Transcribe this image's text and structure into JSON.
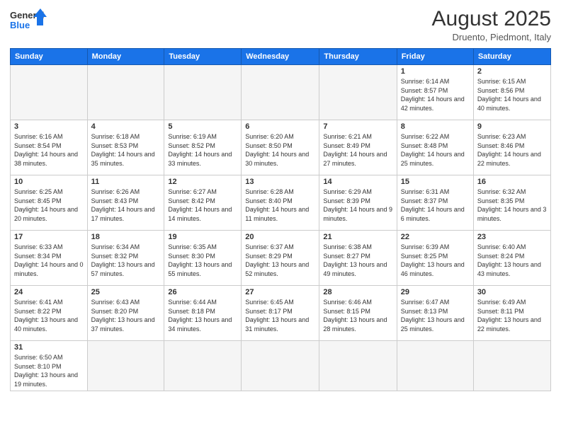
{
  "logo": {
    "line1": "General",
    "line2": "Blue"
  },
  "title": "August 2025",
  "location": "Druento, Piedmont, Italy",
  "weekdays": [
    "Sunday",
    "Monday",
    "Tuesday",
    "Wednesday",
    "Thursday",
    "Friday",
    "Saturday"
  ],
  "weeks": [
    [
      {
        "day": "",
        "info": ""
      },
      {
        "day": "",
        "info": ""
      },
      {
        "day": "",
        "info": ""
      },
      {
        "day": "",
        "info": ""
      },
      {
        "day": "",
        "info": ""
      },
      {
        "day": "1",
        "info": "Sunrise: 6:14 AM\nSunset: 8:57 PM\nDaylight: 14 hours and 42 minutes."
      },
      {
        "day": "2",
        "info": "Sunrise: 6:15 AM\nSunset: 8:56 PM\nDaylight: 14 hours and 40 minutes."
      }
    ],
    [
      {
        "day": "3",
        "info": "Sunrise: 6:16 AM\nSunset: 8:54 PM\nDaylight: 14 hours and 38 minutes."
      },
      {
        "day": "4",
        "info": "Sunrise: 6:18 AM\nSunset: 8:53 PM\nDaylight: 14 hours and 35 minutes."
      },
      {
        "day": "5",
        "info": "Sunrise: 6:19 AM\nSunset: 8:52 PM\nDaylight: 14 hours and 33 minutes."
      },
      {
        "day": "6",
        "info": "Sunrise: 6:20 AM\nSunset: 8:50 PM\nDaylight: 14 hours and 30 minutes."
      },
      {
        "day": "7",
        "info": "Sunrise: 6:21 AM\nSunset: 8:49 PM\nDaylight: 14 hours and 27 minutes."
      },
      {
        "day": "8",
        "info": "Sunrise: 6:22 AM\nSunset: 8:48 PM\nDaylight: 14 hours and 25 minutes."
      },
      {
        "day": "9",
        "info": "Sunrise: 6:23 AM\nSunset: 8:46 PM\nDaylight: 14 hours and 22 minutes."
      }
    ],
    [
      {
        "day": "10",
        "info": "Sunrise: 6:25 AM\nSunset: 8:45 PM\nDaylight: 14 hours and 20 minutes."
      },
      {
        "day": "11",
        "info": "Sunrise: 6:26 AM\nSunset: 8:43 PM\nDaylight: 14 hours and 17 minutes."
      },
      {
        "day": "12",
        "info": "Sunrise: 6:27 AM\nSunset: 8:42 PM\nDaylight: 14 hours and 14 minutes."
      },
      {
        "day": "13",
        "info": "Sunrise: 6:28 AM\nSunset: 8:40 PM\nDaylight: 14 hours and 11 minutes."
      },
      {
        "day": "14",
        "info": "Sunrise: 6:29 AM\nSunset: 8:39 PM\nDaylight: 14 hours and 9 minutes."
      },
      {
        "day": "15",
        "info": "Sunrise: 6:31 AM\nSunset: 8:37 PM\nDaylight: 14 hours and 6 minutes."
      },
      {
        "day": "16",
        "info": "Sunrise: 6:32 AM\nSunset: 8:35 PM\nDaylight: 14 hours and 3 minutes."
      }
    ],
    [
      {
        "day": "17",
        "info": "Sunrise: 6:33 AM\nSunset: 8:34 PM\nDaylight: 14 hours and 0 minutes."
      },
      {
        "day": "18",
        "info": "Sunrise: 6:34 AM\nSunset: 8:32 PM\nDaylight: 13 hours and 57 minutes."
      },
      {
        "day": "19",
        "info": "Sunrise: 6:35 AM\nSunset: 8:30 PM\nDaylight: 13 hours and 55 minutes."
      },
      {
        "day": "20",
        "info": "Sunrise: 6:37 AM\nSunset: 8:29 PM\nDaylight: 13 hours and 52 minutes."
      },
      {
        "day": "21",
        "info": "Sunrise: 6:38 AM\nSunset: 8:27 PM\nDaylight: 13 hours and 49 minutes."
      },
      {
        "day": "22",
        "info": "Sunrise: 6:39 AM\nSunset: 8:25 PM\nDaylight: 13 hours and 46 minutes."
      },
      {
        "day": "23",
        "info": "Sunrise: 6:40 AM\nSunset: 8:24 PM\nDaylight: 13 hours and 43 minutes."
      }
    ],
    [
      {
        "day": "24",
        "info": "Sunrise: 6:41 AM\nSunset: 8:22 PM\nDaylight: 13 hours and 40 minutes."
      },
      {
        "day": "25",
        "info": "Sunrise: 6:43 AM\nSunset: 8:20 PM\nDaylight: 13 hours and 37 minutes."
      },
      {
        "day": "26",
        "info": "Sunrise: 6:44 AM\nSunset: 8:18 PM\nDaylight: 13 hours and 34 minutes."
      },
      {
        "day": "27",
        "info": "Sunrise: 6:45 AM\nSunset: 8:17 PM\nDaylight: 13 hours and 31 minutes."
      },
      {
        "day": "28",
        "info": "Sunrise: 6:46 AM\nSunset: 8:15 PM\nDaylight: 13 hours and 28 minutes."
      },
      {
        "day": "29",
        "info": "Sunrise: 6:47 AM\nSunset: 8:13 PM\nDaylight: 13 hours and 25 minutes."
      },
      {
        "day": "30",
        "info": "Sunrise: 6:49 AM\nSunset: 8:11 PM\nDaylight: 13 hours and 22 minutes."
      }
    ],
    [
      {
        "day": "31",
        "info": "Sunrise: 6:50 AM\nSunset: 8:10 PM\nDaylight: 13 hours and 19 minutes."
      },
      {
        "day": "",
        "info": ""
      },
      {
        "day": "",
        "info": ""
      },
      {
        "day": "",
        "info": ""
      },
      {
        "day": "",
        "info": ""
      },
      {
        "day": "",
        "info": ""
      },
      {
        "day": "",
        "info": ""
      }
    ]
  ]
}
